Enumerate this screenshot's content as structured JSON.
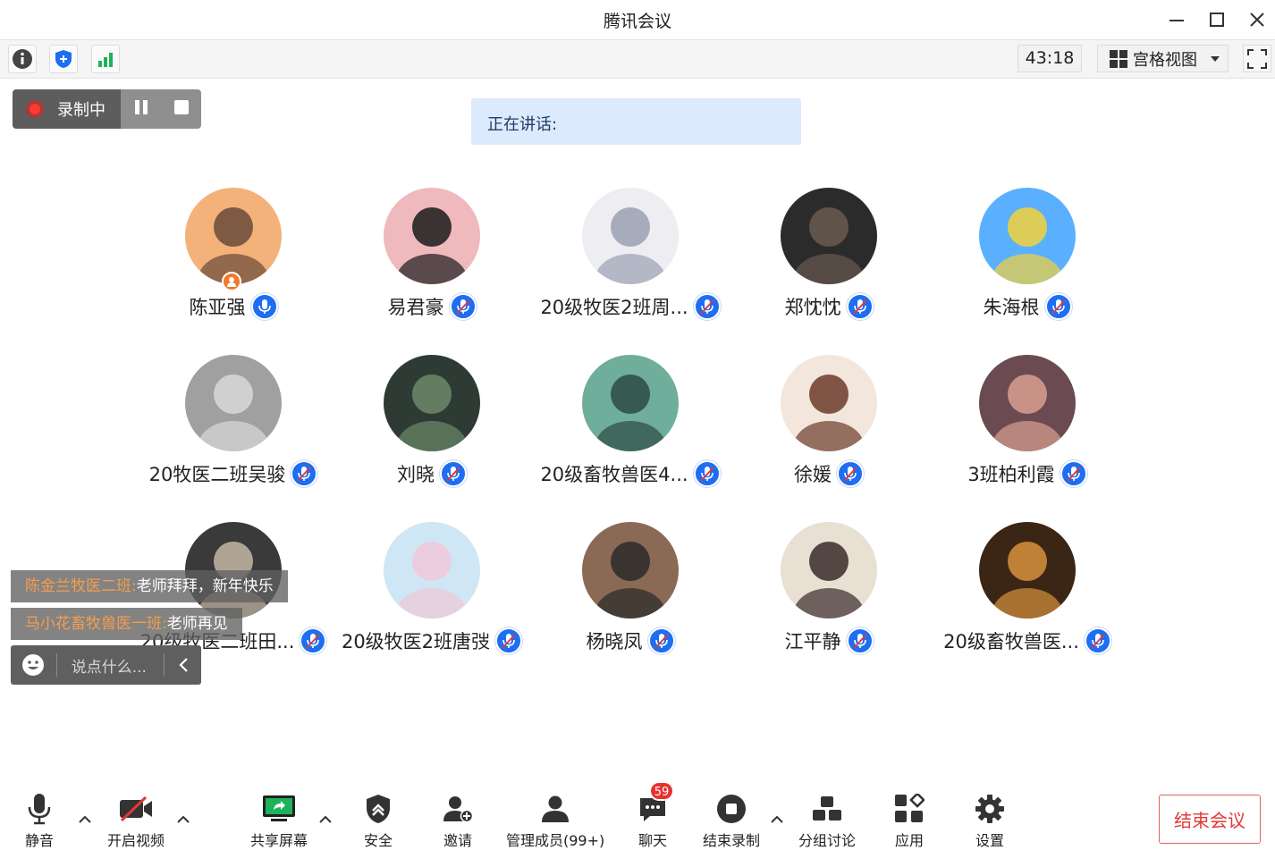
{
  "window": {
    "title": "腾讯会议"
  },
  "toolbar": {
    "timer": "43:18",
    "view_label": "宫格视图"
  },
  "recording": {
    "label": "录制中"
  },
  "speaking": {
    "label": "正在讲话:"
  },
  "participants": [
    {
      "name": "陈亚强",
      "mic": "on",
      "host": true
    },
    {
      "name": "易君豪",
      "mic": "muted"
    },
    {
      "name": "20级牧医2班周...",
      "mic": "muted"
    },
    {
      "name": "郑忱忱",
      "mic": "muted"
    },
    {
      "name": "朱海根",
      "mic": "muted"
    },
    {
      "name": "20牧医二班吴骏",
      "mic": "muted"
    },
    {
      "name": "刘晓",
      "mic": "muted"
    },
    {
      "name": "20级畜牧兽医4...",
      "mic": "muted"
    },
    {
      "name": "徐媛",
      "mic": "muted"
    },
    {
      "name": "3班柏利霞",
      "mic": "muted"
    },
    {
      "name": "20级牧医二班田...",
      "mic": "muted"
    },
    {
      "name": "20级牧医2班唐弢",
      "mic": "muted"
    },
    {
      "name": "杨晓凤",
      "mic": "muted"
    },
    {
      "name": "江平静",
      "mic": "muted"
    },
    {
      "name": "20级畜牧兽医...",
      "mic": "muted"
    }
  ],
  "chat": {
    "messages": [
      {
        "sender": "陈金兰牧医二班:",
        "text": "老师拜拜，新年快乐"
      },
      {
        "sender": "马小花畜牧兽医一班:",
        "text": "老师再见"
      }
    ],
    "input_placeholder": "说点什么..."
  },
  "bottom": {
    "mute": "静音",
    "video": "开启视频",
    "share": "共享屏幕",
    "security": "安全",
    "invite": "邀请",
    "members": "管理成员(99+)",
    "chat": "聊天",
    "chat_badge": "59",
    "stop_record": "结束录制",
    "breakout": "分组讨论",
    "apps": "应用",
    "settings": "设置",
    "end_meeting": "结束会议"
  },
  "colors": {
    "accent_blue": "#1e6ef2",
    "end_red": "#e23838",
    "chat_sender": "#f59d4c",
    "speaking_bg": "#dceafd"
  }
}
